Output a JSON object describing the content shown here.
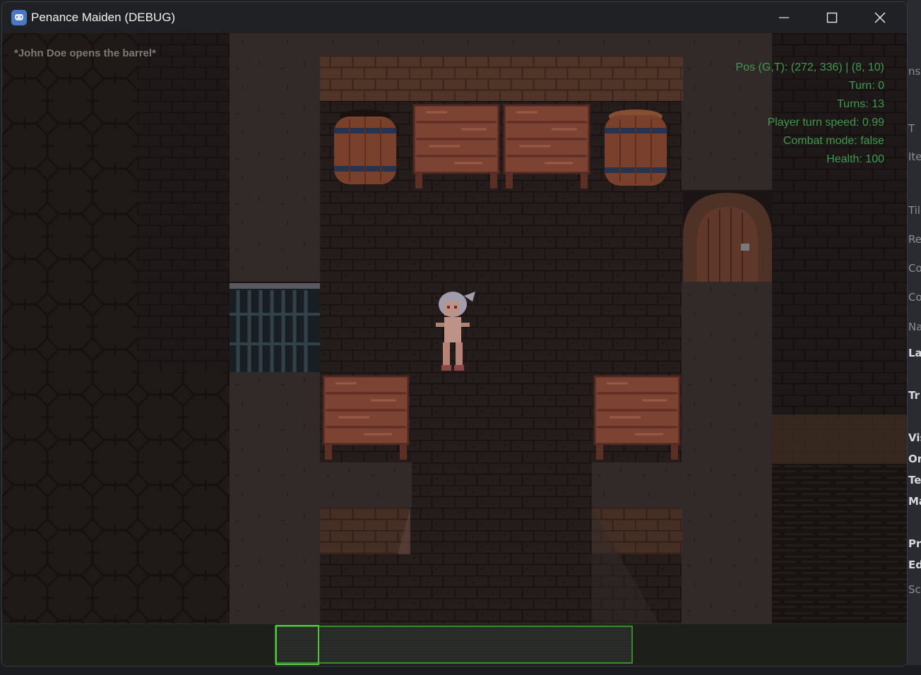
{
  "window": {
    "title": "Penance Maiden (DEBUG)",
    "icon": "godot-engine-icon",
    "controls": [
      "minimize-icon",
      "maximize-icon",
      "close-icon"
    ]
  },
  "game": {
    "event_message": "*John Doe opens the barrel*",
    "debug": {
      "pos": "Pos (G,T): (272, 336) | (8, 10)",
      "turn": "Turn: 0",
      "turns": "Turns: 13",
      "player_turn_speed": "Player turn speed: 0.99",
      "combat_mode": "Combat mode: false",
      "health": "Health: 100"
    },
    "hotbar": {
      "selected_slot": 1
    }
  },
  "editor_behind": {
    "labels": [
      "nsp",
      "Tile",
      "Ren",
      "Col",
      "Col",
      "Nav",
      "La",
      "Tr",
      "Vis",
      "Or",
      "Te",
      "Ma",
      "Pr",
      "Ed",
      "Scr",
      "Ite",
      "T"
    ]
  },
  "colors": {
    "debug_text": "#3f9a4d",
    "event_text": "#807870",
    "hotbar_border": "#3c8a2f",
    "hotbar_selected": "#53c23f"
  }
}
